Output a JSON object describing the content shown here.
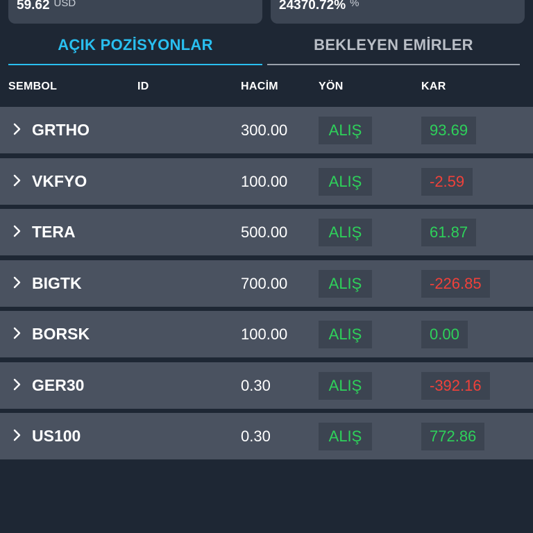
{
  "summary": {
    "left_value": "59.62",
    "left_unit": "USD",
    "right_value": "24370.72%",
    "right_unit": "%"
  },
  "tabs": [
    {
      "label": "AÇIK POZİSYONLAR",
      "active": true
    },
    {
      "label": "BEKLEYEN EMİRLER",
      "active": false
    }
  ],
  "columns": {
    "symbol": "SEMBOL",
    "id": "ID",
    "volume": "HACİM",
    "direction": "YÖN",
    "profit": "KAR"
  },
  "positions": [
    {
      "symbol": "GRTHO",
      "volume": "300.00",
      "direction": "ALIŞ",
      "profit": "93.69",
      "profit_sign": "pos"
    },
    {
      "symbol": "VKFYO",
      "volume": "100.00",
      "direction": "ALIŞ",
      "profit": "-2.59",
      "profit_sign": "neg"
    },
    {
      "symbol": "TERA",
      "volume": "500.00",
      "direction": "ALIŞ",
      "profit": "61.87",
      "profit_sign": "pos"
    },
    {
      "symbol": "BIGTK",
      "volume": "700.00",
      "direction": "ALIŞ",
      "profit": "-226.85",
      "profit_sign": "neg"
    },
    {
      "symbol": "BORSK",
      "volume": "100.00",
      "direction": "ALIŞ",
      "profit": "0.00",
      "profit_sign": "pos"
    },
    {
      "symbol": "GER30",
      "volume": "0.30",
      "direction": "ALIŞ",
      "profit": "-392.16",
      "profit_sign": "neg"
    },
    {
      "symbol": "US100",
      "volume": "0.30",
      "direction": "ALIŞ",
      "profit": "772.86",
      "profit_sign": "pos"
    }
  ],
  "colors": {
    "accent": "#29bff0",
    "positive": "#2ed15a",
    "negative": "#f0413a",
    "background": "#1e2734",
    "row": "#4a5260"
  }
}
